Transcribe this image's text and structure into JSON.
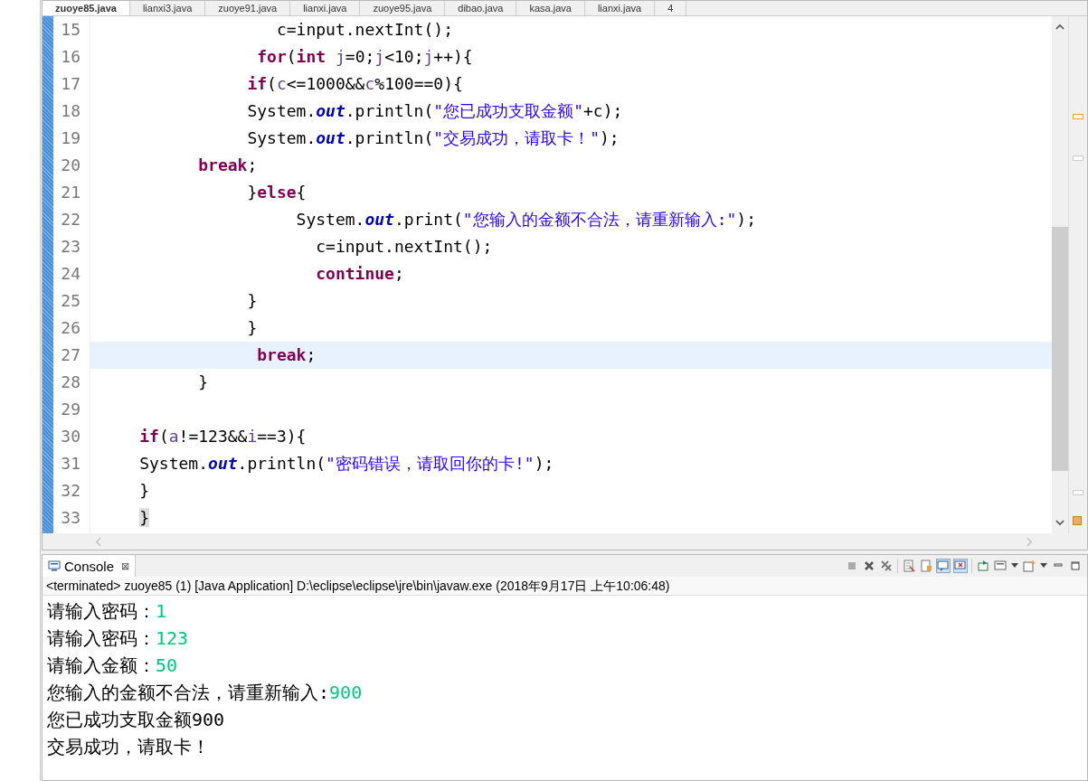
{
  "editor": {
    "tabs": [
      {
        "label": "zuoye85.java",
        "selected": true
      },
      {
        "label": "lianxi3.java",
        "selected": false
      },
      {
        "label": "zuoye91.java",
        "selected": false
      },
      {
        "label": "lianxi.java",
        "selected": false
      },
      {
        "label": "zuoye95.java",
        "selected": false
      },
      {
        "label": "dibao.java",
        "selected": false
      },
      {
        "label": "kasa.java",
        "selected": false
      },
      {
        "label": "lianxi.java",
        "selected": false
      },
      {
        "label": "4",
        "selected": false
      }
    ],
    "lines": [
      {
        "number": "15",
        "current": false,
        "tokens": [
          {
            "kind": "plain",
            "text": "                   c=input.nextInt();"
          }
        ]
      },
      {
        "number": "16",
        "current": false,
        "tokens": [
          {
            "kind": "kw",
            "text": "                 for"
          },
          {
            "kind": "plain",
            "text": "("
          },
          {
            "kind": "kw",
            "text": "int"
          },
          {
            "kind": "var",
            "text": " j"
          },
          {
            "kind": "plain",
            "text": "=0;"
          },
          {
            "kind": "var",
            "text": "j"
          },
          {
            "kind": "plain",
            "text": "<10;"
          },
          {
            "kind": "var",
            "text": "j"
          },
          {
            "kind": "plain",
            "text": "++){"
          }
        ]
      },
      {
        "number": "17",
        "current": false,
        "tokens": [
          {
            "kind": "kw",
            "text": "                if"
          },
          {
            "kind": "plain",
            "text": "("
          },
          {
            "kind": "var",
            "text": "c"
          },
          {
            "kind": "plain",
            "text": "<=1000&&"
          },
          {
            "kind": "var",
            "text": "c"
          },
          {
            "kind": "plain",
            "text": "%100==0){"
          }
        ]
      },
      {
        "number": "18",
        "current": false,
        "tokens": [
          {
            "kind": "plain",
            "text": "                System."
          },
          {
            "kind": "field",
            "text": "out"
          },
          {
            "kind": "plain",
            "text": ".println("
          },
          {
            "kind": "str",
            "text": "\"您已成功支取金额\""
          },
          {
            "kind": "plain",
            "text": "+c);"
          }
        ]
      },
      {
        "number": "19",
        "current": false,
        "tokens": [
          {
            "kind": "plain",
            "text": "                System."
          },
          {
            "kind": "field",
            "text": "out"
          },
          {
            "kind": "plain",
            "text": ".println("
          },
          {
            "kind": "str",
            "text": "\"交易成功，请取卡！\""
          },
          {
            "kind": "plain",
            "text": ");"
          }
        ]
      },
      {
        "number": "20",
        "current": false,
        "tokens": [
          {
            "kind": "kw",
            "text": "           break"
          },
          {
            "kind": "plain",
            "text": ";"
          }
        ]
      },
      {
        "number": "21",
        "current": false,
        "tokens": [
          {
            "kind": "plain",
            "text": "                }"
          },
          {
            "kind": "kw",
            "text": "else"
          },
          {
            "kind": "plain",
            "text": "{"
          }
        ]
      },
      {
        "number": "22",
        "current": false,
        "tokens": [
          {
            "kind": "plain",
            "text": "                     System."
          },
          {
            "kind": "field",
            "text": "out"
          },
          {
            "kind": "plain",
            "text": ".print("
          },
          {
            "kind": "str",
            "text": "\"您输入的金额不合法，请重新输入:\""
          },
          {
            "kind": "plain",
            "text": ");"
          }
        ]
      },
      {
        "number": "23",
        "current": false,
        "tokens": [
          {
            "kind": "plain",
            "text": "                       c=input.nextInt();"
          }
        ]
      },
      {
        "number": "24",
        "current": false,
        "tokens": [
          {
            "kind": "kw",
            "text": "                       continue"
          },
          {
            "kind": "plain",
            "text": ";"
          }
        ]
      },
      {
        "number": "25",
        "current": false,
        "tokens": [
          {
            "kind": "plain",
            "text": "                }"
          }
        ]
      },
      {
        "number": "26",
        "current": false,
        "tokens": [
          {
            "kind": "plain",
            "text": "                }"
          }
        ]
      },
      {
        "number": "27",
        "current": true,
        "tokens": [
          {
            "kind": "kw",
            "text": "                 break"
          },
          {
            "kind": "plain",
            "text": ";"
          }
        ]
      },
      {
        "number": "28",
        "current": false,
        "tokens": [
          {
            "kind": "plain",
            "text": "           }"
          }
        ]
      },
      {
        "number": "29",
        "current": false
      },
      {
        "number": "30",
        "current": false,
        "tokens": [
          {
            "kind": "kw",
            "text": "     if"
          },
          {
            "kind": "plain",
            "text": "("
          },
          {
            "kind": "var",
            "text": "a"
          },
          {
            "kind": "plain",
            "text": "!=123&&"
          },
          {
            "kind": "var",
            "text": "i"
          },
          {
            "kind": "plain",
            "text": "==3){"
          }
        ]
      },
      {
        "number": "31",
        "current": false,
        "tokens": [
          {
            "kind": "plain",
            "text": "     System."
          },
          {
            "kind": "field",
            "text": "out"
          },
          {
            "kind": "plain",
            "text": ".println("
          },
          {
            "kind": "str",
            "text": "\"密码错误，请取回你的卡!\""
          },
          {
            "kind": "plain",
            "text": ");"
          }
        ]
      },
      {
        "number": "32",
        "current": false,
        "tokens": [
          {
            "kind": "plain",
            "text": "     }"
          }
        ]
      },
      {
        "number": "33",
        "current": false,
        "tokens": [
          {
            "kind": "match",
            "text": "     }"
          }
        ]
      }
    ]
  },
  "console": {
    "title": "Console",
    "close": "⊠",
    "status": "<terminated> zuoye85 (1) [Java Application] D:\\eclipse\\eclipse\\jre\\bin\\javaw.exe (2018年9月17日 上午10:06:48)",
    "lines": [
      [
        {
          "kind": "out",
          "text": "请输入密码："
        },
        {
          "kind": "in",
          "text": "1"
        }
      ],
      [
        {
          "kind": "out",
          "text": "请输入密码："
        },
        {
          "kind": "in",
          "text": "123"
        }
      ],
      [
        {
          "kind": "out",
          "text": "请输入金额："
        },
        {
          "kind": "in",
          "text": "50"
        }
      ],
      [
        {
          "kind": "out",
          "text": "您输入的金额不合法，请重新输入:"
        },
        {
          "kind": "in",
          "text": "900"
        }
      ],
      [
        {
          "kind": "out",
          "text": "您已成功支取金额900"
        }
      ],
      [
        {
          "kind": "out",
          "text": "交易成功，请取卡！"
        }
      ]
    ]
  }
}
